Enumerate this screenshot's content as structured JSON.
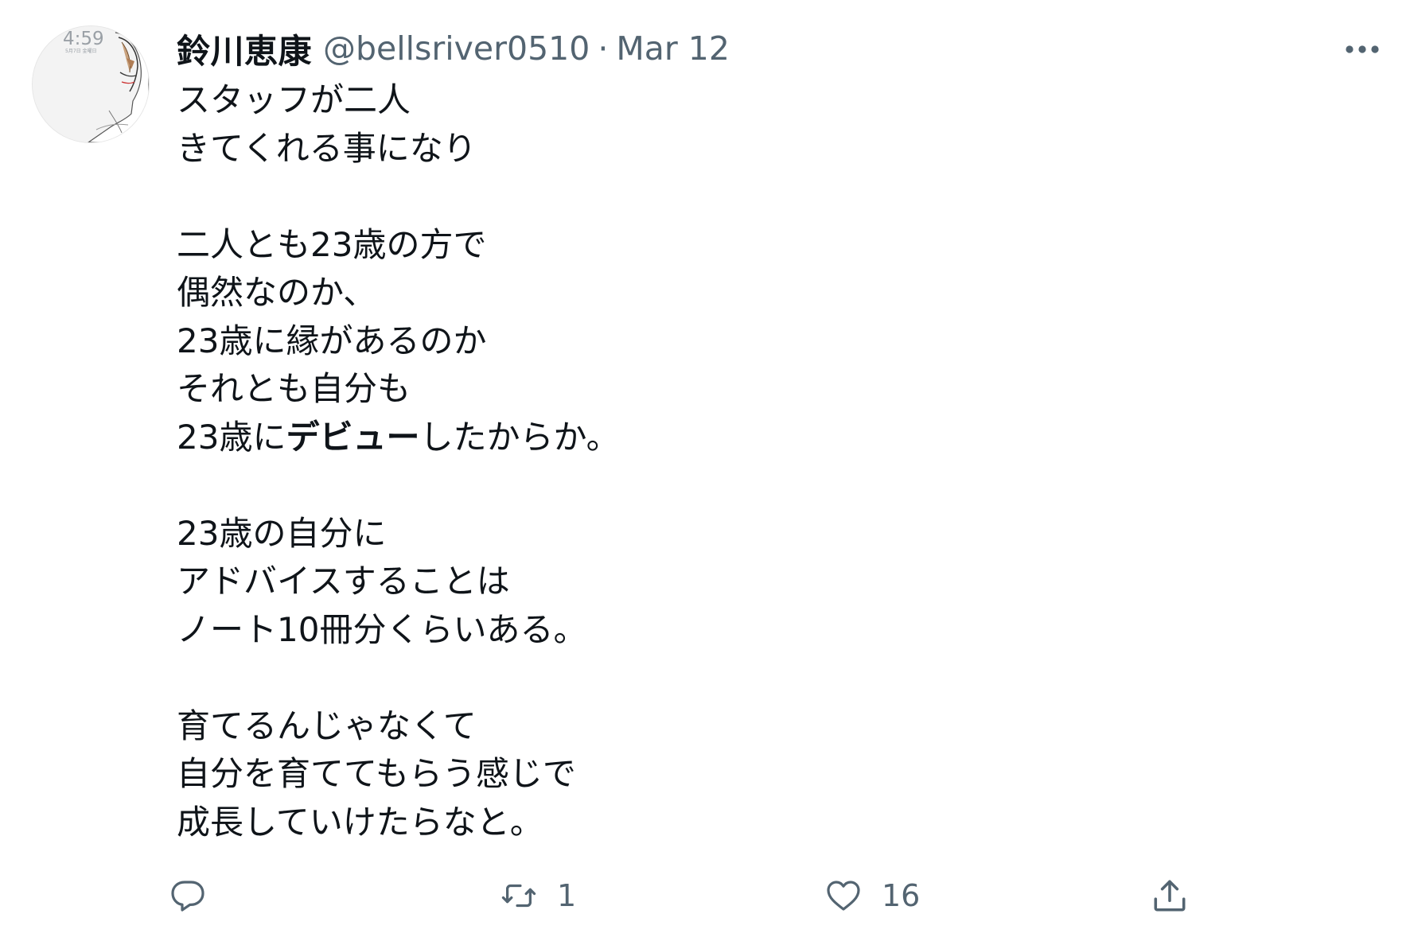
{
  "tweet": {
    "display_name": "鈴川恵康",
    "handle": "@bellsriver0510",
    "separator": "·",
    "date": "Mar 12",
    "avatar": {
      "clock_text": "4:59",
      "date_text": "5月7日 金曜日"
    },
    "body": {
      "line1": "スタッフが二人",
      "line2": "きてくれる事になり",
      "line4": "二人とも23歳の方で",
      "line5": "偶然なのか、",
      "line6": "23歳に縁があるのか",
      "line7": "それとも自分も",
      "line8_pre": "23歳に",
      "line8_bold": "デビュー",
      "line8_post": "したからか。",
      "line10": "23歳の自分に",
      "line11": "アドバイスすることは",
      "line12": "ノート10冊分くらいある。",
      "line14": "育てるんじゃなくて",
      "line15": "自分を育ててもらう感じで",
      "line16": "成長していけたらなと。"
    },
    "actions": {
      "reply_count": "",
      "retweet_count": "1",
      "like_count": "16",
      "share_count": ""
    },
    "icons": {
      "reply": "reply-icon",
      "retweet": "retweet-icon",
      "like": "heart-icon",
      "share": "share-icon",
      "more": "more-options-icon"
    },
    "colors": {
      "text": "#0f1419",
      "secondary": "#536471"
    }
  }
}
